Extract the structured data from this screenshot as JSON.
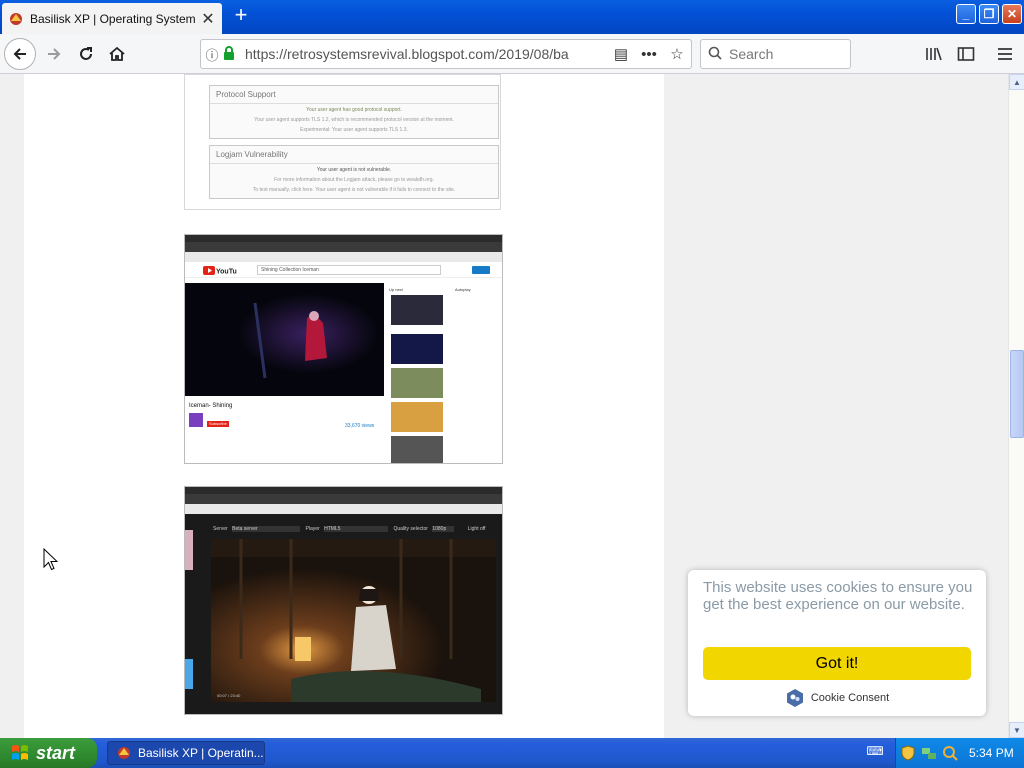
{
  "browser": {
    "tab_title": "Basilisk XP | Operating System Re",
    "url": "https://retrosystemsrevival.blogspot.com/2019/08/ba",
    "search_placeholder": "Search",
    "new_tab_symbol": "+"
  },
  "page": {
    "protocol_box": {
      "title": "Protocol Support",
      "line1": "Your user agent has good protocol support.",
      "line2": "Your user agent supports TLS 1.2, which is recommended protocol version at the moment.",
      "line3": "Experimental: Your user agent supports TLS 1.3."
    },
    "logjam_box": {
      "title": "Logjam Vulnerability",
      "line1": "Your user agent is not vulnerable.",
      "line2": "For more information about the Logjam attack, please go to weakdh.org.",
      "line3": "To test manually, click here. Your user agent is not vulnerable if it fails to connect to the site."
    },
    "youtube_shot": {
      "search_text": "Shining Collection Iceman",
      "video_title": "Iceman- Shining",
      "views": "33,670 views",
      "subscribe": "Subscribe",
      "upnext": "Up next",
      "autoplay": "Autoplay"
    },
    "player_shot": {
      "server_label": "Server",
      "server_value": "Beta server",
      "player_label": "Player",
      "player_value": "HTML5",
      "quality_label": "Quality selector",
      "quality_value": "1080p",
      "light_label": "Light off",
      "time": "00:07 / 23:40"
    }
  },
  "cookie": {
    "message": "This website uses cookies to ensure you get the best experience on our website.",
    "button": "Got it!",
    "brand": "Cookie Consent",
    "button_color": "#f1d600"
  },
  "taskbar": {
    "start_label": "start",
    "task_label": "Basilisk XP | Operatin...",
    "clock": "5:34 PM"
  }
}
